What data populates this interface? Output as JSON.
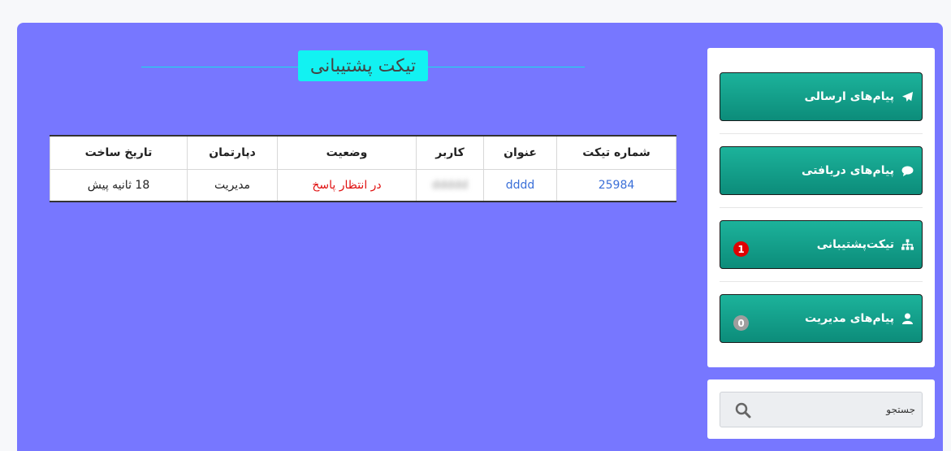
{
  "page": {
    "title": "تیکت پشتیبانی"
  },
  "table": {
    "headers": [
      "شماره تیکت",
      "عنوان",
      "کاربر",
      "وضعیت",
      "دپارتمان",
      "تاریخ ساخت"
    ],
    "rows": [
      {
        "ticket_no": "25984",
        "subject": "dddd",
        "user": "ddddd",
        "status": "در انتظار پاسخ",
        "department": "مدیریت",
        "created": "18 ثانیه پیش"
      }
    ]
  },
  "sidebar": {
    "items": [
      {
        "label": "پیام‌های ارسالی",
        "icon": "paper-plane-icon"
      },
      {
        "label": "پیام‌های دریافتی",
        "icon": "comment-icon"
      },
      {
        "label": "تیکت‌پشتیبانی",
        "icon": "sitemap-icon",
        "badge": "1",
        "badge_color": "#e00000"
      },
      {
        "label": "پیام‌های مدیریت",
        "icon": "user-icon",
        "badge": "0",
        "badge_color": "#9e9e9e"
      }
    ]
  },
  "search": {
    "placeholder": "جستجو",
    "value": ""
  },
  "colors": {
    "panel": "#7777ff",
    "title_bg": "#12f2f2",
    "button": "#119f8a",
    "pending": "#e01010",
    "link": "#3a6fd8"
  }
}
